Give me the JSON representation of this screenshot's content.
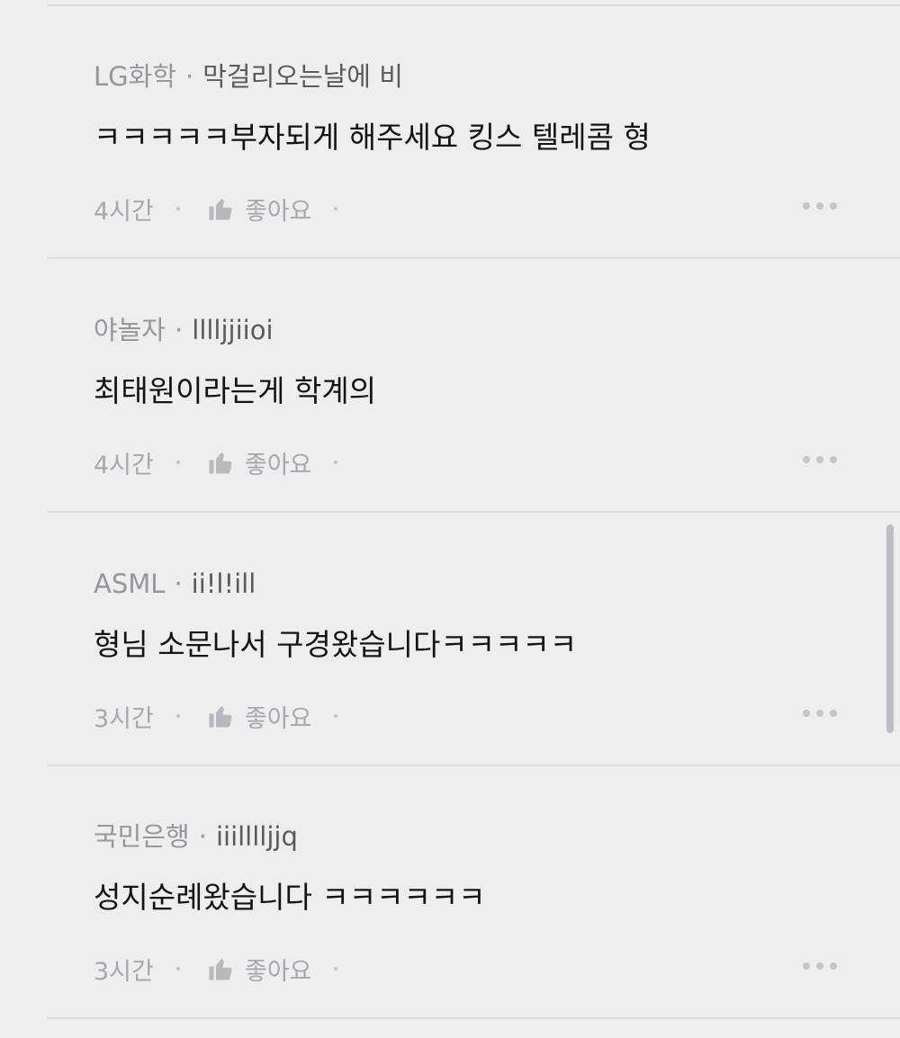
{
  "comments": [
    {
      "author": "LG화학",
      "nickname": "막걸리오는날에 비",
      "text": "ㅋㅋㅋㅋㅋ부자되게 해주세요 킹스 텔레콤 형",
      "time": "4시간",
      "like_label": "좋아요"
    },
    {
      "author": "야놀자",
      "nickname": "lllljjiioi",
      "text": "최태원이라는게 학계의",
      "time": "4시간",
      "like_label": "좋아요"
    },
    {
      "author": "ASML",
      "nickname": "ii!l!ill",
      "text": "형님 소문나서 구경왔습니다ㅋㅋㅋㅋㅋ",
      "time": "3시간",
      "like_label": "좋아요"
    },
    {
      "author": "국민은행",
      "nickname": "iiilllljjq",
      "text": "성지순례왔습니다 ㅋㅋㅋㅋㅋㅋ",
      "time": "3시간",
      "like_label": "좋아요"
    }
  ],
  "separator": "·",
  "icons": {
    "like": "thumbs-up-icon",
    "more": "more-options-icon"
  },
  "colors": {
    "background": "#eeeeef",
    "meta_text": "#96969b",
    "body_text": "#141414",
    "action_text": "#a7a7ac"
  }
}
